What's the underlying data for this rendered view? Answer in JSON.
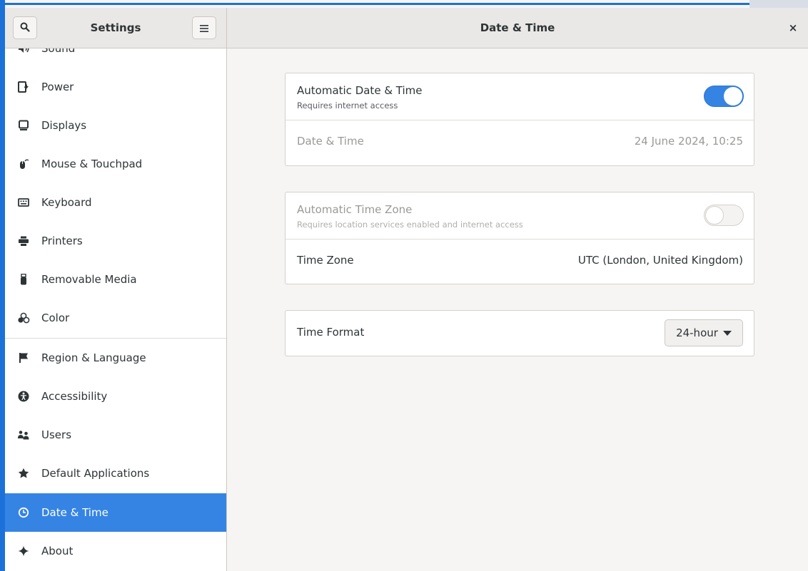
{
  "header": {
    "sidebar_title": "Settings",
    "title": "Date & Time",
    "search_icon": "search-icon",
    "menu_icon": "hamburger-menu-icon",
    "close_label": "×"
  },
  "sidebar": {
    "items": [
      {
        "label": "Sound",
        "icon": "speaker-icon"
      },
      {
        "label": "Power",
        "icon": "power-plug-icon"
      },
      {
        "label": "Displays",
        "icon": "monitor-icon"
      },
      {
        "label": "Mouse & Touchpad",
        "icon": "mouse-icon"
      },
      {
        "label": "Keyboard",
        "icon": "keyboard-icon"
      },
      {
        "label": "Printers",
        "icon": "printer-icon"
      },
      {
        "label": "Removable Media",
        "icon": "usb-drive-icon"
      },
      {
        "label": "Color",
        "icon": "color-circles-icon"
      },
      {
        "label": "Region & Language",
        "icon": "flag-icon"
      },
      {
        "label": "Accessibility",
        "icon": "accessibility-icon"
      },
      {
        "label": "Users",
        "icon": "users-icon"
      },
      {
        "label": "Default Applications",
        "icon": "star-icon"
      },
      {
        "label": "Date & Time",
        "icon": "clock-icon",
        "active": true
      },
      {
        "label": "About",
        "icon": "sparkle-icon"
      }
    ]
  },
  "panels": {
    "auto_datetime": {
      "label": "Automatic Date & Time",
      "sub": "Requires internet access",
      "enabled": true
    },
    "datetime": {
      "label": "Date & Time",
      "value": "24 June 2024, 10:25"
    },
    "auto_timezone": {
      "label": "Automatic Time Zone",
      "sub": "Requires location services enabled and internet access",
      "enabled": false
    },
    "timezone": {
      "label": "Time Zone",
      "value": "UTC (London, United Kingdom)"
    },
    "time_format": {
      "label": "Time Format",
      "value": "24-hour"
    }
  },
  "colors": {
    "accent": "#3584e4",
    "window_border": "#1c71d8"
  }
}
